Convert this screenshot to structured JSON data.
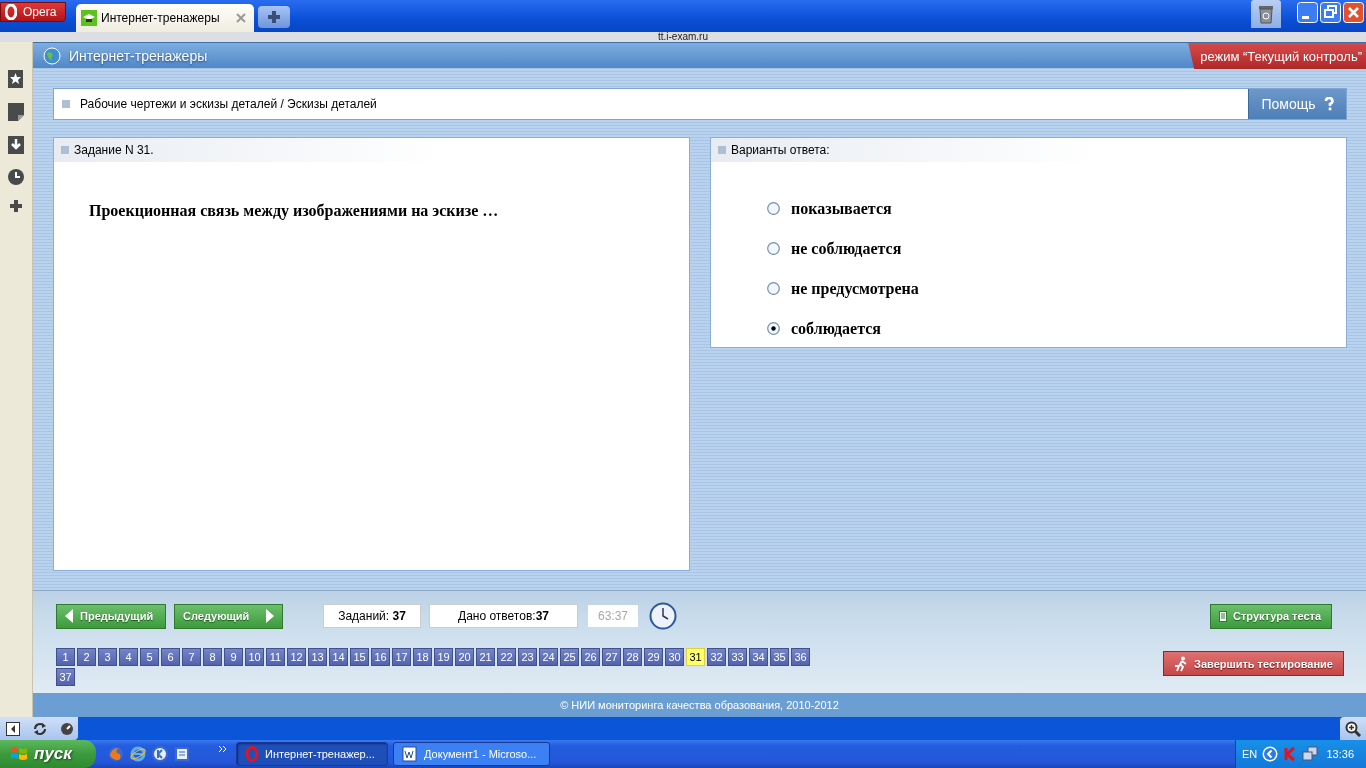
{
  "browser": {
    "menu_button": "Opera",
    "tabs": [
      {
        "label": "Интернет-тренажеры",
        "selected": true
      }
    ],
    "address": "tt.i-exam.ru"
  },
  "site": {
    "title": "Интернет-тренажеры",
    "mode_badge": "режим “Текущий контроль”"
  },
  "breadcrumb": {
    "text": "Рабочие чертежи и эскизы деталей / Эскизы деталей",
    "help_button": "Помощь"
  },
  "question": {
    "heading": "Задание N 31.",
    "text": "Проекционная связь между изображениями на эскизе …"
  },
  "answers": {
    "heading": "Варианты ответа:",
    "options": [
      {
        "label": "показывается",
        "selected": false
      },
      {
        "label": "не соблюдается",
        "selected": false
      },
      {
        "label": "не предусмотрена",
        "selected": false
      },
      {
        "label": "соблюдается",
        "selected": true
      }
    ]
  },
  "nav": {
    "prev_button": "Предыдущий",
    "next_button": "Следующий",
    "tasks": "Заданий: **37**",
    "answered": "Дано ответов:**37**",
    "timer": "63:37",
    "structure_button": "Структура теста",
    "finish_button": "Завершить тестирование"
  },
  "task_numbers": [
    {
      "label": "1",
      "selected": false
    },
    {
      "label": "2",
      "selected": false
    },
    {
      "label": "3",
      "selected": false
    },
    {
      "label": "4",
      "selected": false
    },
    {
      "label": "5",
      "selected": false
    },
    {
      "label": "6",
      "selected": false
    },
    {
      "label": "7",
      "selected": false
    },
    {
      "label": "8",
      "selected": false
    },
    {
      "label": "9",
      "selected": false
    },
    {
      "label": "10",
      "selected": false
    },
    {
      "label": "11",
      "selected": false
    },
    {
      "label": "12",
      "selected": false
    },
    {
      "label": "13",
      "selected": false
    },
    {
      "label": "14",
      "selected": false
    },
    {
      "label": "15",
      "selected": false
    },
    {
      "label": "16",
      "selected": false
    },
    {
      "label": "17",
      "selected": false
    },
    {
      "label": "18",
      "selected": false
    },
    {
      "label": "19",
      "selected": false
    },
    {
      "label": "20",
      "selected": false
    },
    {
      "label": "21",
      "selected": false
    },
    {
      "label": "22",
      "selected": false
    },
    {
      "label": "23",
      "selected": false
    },
    {
      "label": "24",
      "selected": false
    },
    {
      "label": "25",
      "selected": false
    },
    {
      "label": "26",
      "selected": false
    },
    {
      "label": "27",
      "selected": false
    },
    {
      "label": "28",
      "selected": false
    },
    {
      "label": "29",
      "selected": false
    },
    {
      "label": "30",
      "selected": false
    },
    {
      "label": "31",
      "selected": true
    },
    {
      "label": "32",
      "selected": false
    },
    {
      "label": "33",
      "selected": false
    },
    {
      "label": "34",
      "selected": false
    },
    {
      "label": "35",
      "selected": false
    },
    {
      "label": "36",
      "selected": false
    },
    {
      "label": "37",
      "selected": false
    }
  ],
  "footer": "© НИИ мониторинга качества образования, 2010-2012",
  "taskbar": {
    "start_button": "пуск",
    "windows": [
      {
        "label": "Интернет-тренажер...",
        "selected": true
      },
      {
        "label": "Документ1 - Microso...",
        "selected": false
      }
    ],
    "language": "EN",
    "clock": "13:36"
  }
}
